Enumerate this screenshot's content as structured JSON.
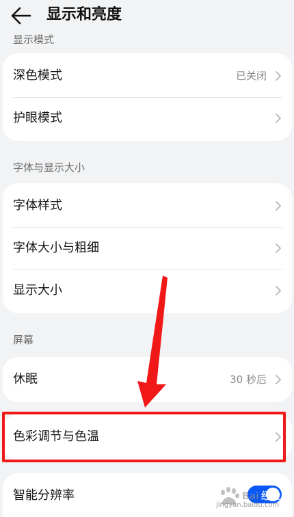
{
  "header": {
    "title": "显示和亮度",
    "back_icon": "back-arrow-icon"
  },
  "sections": {
    "display_mode_label": "显示模式",
    "font_label": "字体与显示大小",
    "screen_label": "屏幕"
  },
  "rows": {
    "dark_mode": {
      "label": "深色模式",
      "value": "已关闭"
    },
    "eye_comfort": {
      "label": "护眼模式"
    },
    "font_style": {
      "label": "字体样式"
    },
    "font_size_weight": {
      "label": "字体大小与粗细"
    },
    "display_size": {
      "label": "显示大小"
    },
    "sleep": {
      "label": "休眠",
      "value": "30 秒后"
    },
    "color_temp": {
      "label": "色彩调节与色温"
    },
    "smart_resolution": {
      "label": "智能分辨率",
      "toggle_on": true
    }
  },
  "annotation": {
    "highlight_color": "#f11818",
    "arrow_color": "#f11818"
  },
  "watermark": {
    "text": "jingyan.baidu.com"
  },
  "colors": {
    "background": "#f1f3f5",
    "card": "#ffffff",
    "accent": "#0a59f7"
  }
}
